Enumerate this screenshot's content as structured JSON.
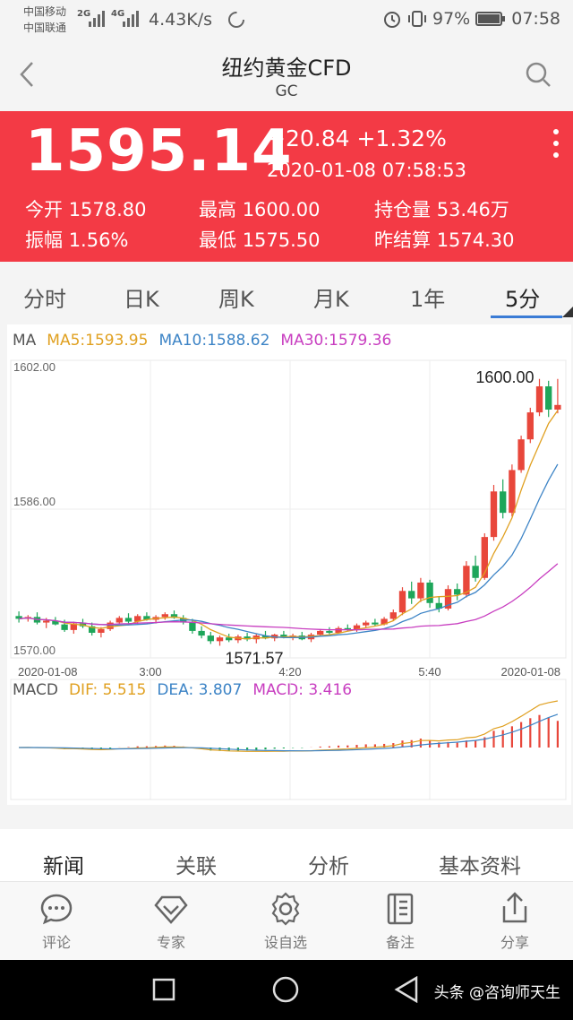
{
  "status": {
    "carrier1": "中国移动",
    "carrier2": "中国联通",
    "net1": "2G",
    "net2": "4G",
    "speed": "4.43K/s",
    "battery": "97%",
    "time": "07:58"
  },
  "header": {
    "title": "纽约黄金CFD",
    "subtitle": "GC"
  },
  "quote": {
    "price": "1595.14",
    "change": "+20.84 +1.32%",
    "datetime": "2020-01-08 07:58:53",
    "open_label": "今开",
    "open": "1578.80",
    "high_label": "最高",
    "high": "1600.00",
    "oi_label": "持仓量",
    "oi": "53.46万",
    "amp_label": "振幅",
    "amp": "1.56%",
    "low_label": "最低",
    "low": "1575.50",
    "settle_label": "昨结算",
    "settle": "1574.30"
  },
  "tabs": [
    "分时",
    "日K",
    "周K",
    "月K",
    "1年",
    "5分"
  ],
  "chart_data": {
    "type": "candlestick",
    "ma_legend": {
      "label": "MA",
      "ma5": "MA5:1593.95",
      "ma10": "MA10:1588.62",
      "ma30": "MA30:1579.36"
    },
    "macd_legend": {
      "label": "MACD",
      "dif": "DIF: 5.515",
      "dea": "DEA: 3.807",
      "macd": "MACD: 3.416"
    },
    "y_ticks": [
      "1602.00",
      "1586.00",
      "1570.00"
    ],
    "ylim": [
      1570,
      1602
    ],
    "x_ticks": [
      "2020-01-08",
      "3:00",
      "4:20",
      "5:40",
      "2020-01-08"
    ],
    "annotations": {
      "high": "1600.00",
      "low": "1571.57"
    },
    "candles": [
      [
        1574.5,
        1575.0,
        1573.8,
        1574.2
      ],
      [
        1574.2,
        1574.6,
        1573.9,
        1574.4
      ],
      [
        1574.4,
        1574.9,
        1573.6,
        1573.8
      ],
      [
        1573.8,
        1574.3,
        1573.2,
        1574.0
      ],
      [
        1574.0,
        1574.4,
        1573.5,
        1573.6
      ],
      [
        1573.6,
        1574.1,
        1572.8,
        1573.0
      ],
      [
        1573.0,
        1573.9,
        1572.6,
        1573.7
      ],
      [
        1573.7,
        1574.2,
        1573.2,
        1573.4
      ],
      [
        1573.4,
        1573.8,
        1572.4,
        1572.7
      ],
      [
        1572.7,
        1573.3,
        1572.2,
        1573.1
      ],
      [
        1573.1,
        1574.0,
        1572.9,
        1573.8
      ],
      [
        1573.8,
        1574.5,
        1573.6,
        1574.3
      ],
      [
        1574.3,
        1574.8,
        1573.7,
        1573.9
      ],
      [
        1573.9,
        1574.7,
        1573.6,
        1574.5
      ],
      [
        1574.5,
        1574.9,
        1574.0,
        1574.1
      ],
      [
        1574.1,
        1574.6,
        1573.7,
        1574.4
      ],
      [
        1574.4,
        1574.9,
        1574.1,
        1574.7
      ],
      [
        1574.7,
        1575.1,
        1574.2,
        1574.3
      ],
      [
        1574.3,
        1574.6,
        1573.6,
        1573.8
      ],
      [
        1573.8,
        1574.2,
        1572.6,
        1572.9
      ],
      [
        1572.9,
        1573.4,
        1572.1,
        1572.4
      ],
      [
        1572.4,
        1572.8,
        1571.5,
        1571.8
      ],
      [
        1571.8,
        1572.4,
        1571.3,
        1572.2
      ],
      [
        1572.2,
        1572.6,
        1571.7,
        1571.9
      ],
      [
        1571.9,
        1572.5,
        1571.6,
        1572.3
      ],
      [
        1572.3,
        1572.7,
        1571.8,
        1572.0
      ],
      [
        1572.0,
        1572.6,
        1571.57,
        1572.4
      ],
      [
        1572.4,
        1572.9,
        1572.0,
        1572.1
      ],
      [
        1572.1,
        1572.6,
        1571.8,
        1572.5
      ],
      [
        1572.5,
        1572.9,
        1572.1,
        1572.2
      ],
      [
        1572.2,
        1572.6,
        1571.9,
        1572.4
      ],
      [
        1572.4,
        1572.8,
        1571.9,
        1572.0
      ],
      [
        1572.0,
        1572.7,
        1571.7,
        1572.5
      ],
      [
        1572.5,
        1573.1,
        1572.3,
        1572.9
      ],
      [
        1572.9,
        1573.3,
        1572.5,
        1572.7
      ],
      [
        1572.7,
        1573.4,
        1572.6,
        1573.2
      ],
      [
        1573.2,
        1573.6,
        1572.9,
        1573.0
      ],
      [
        1573.0,
        1573.7,
        1572.8,
        1573.5
      ],
      [
        1573.5,
        1574.0,
        1573.2,
        1573.8
      ],
      [
        1573.8,
        1574.2,
        1573.4,
        1573.6
      ],
      [
        1573.6,
        1574.4,
        1573.5,
        1574.2
      ],
      [
        1574.2,
        1575.2,
        1574.0,
        1574.9
      ],
      [
        1574.9,
        1577.6,
        1574.6,
        1577.2
      ],
      [
        1577.2,
        1578.2,
        1575.8,
        1576.4
      ],
      [
        1576.4,
        1578.6,
        1576.0,
        1578.1
      ],
      [
        1578.1,
        1578.4,
        1575.4,
        1575.9
      ],
      [
        1575.9,
        1576.6,
        1574.9,
        1575.3
      ],
      [
        1575.3,
        1577.8,
        1575.1,
        1577.4
      ],
      [
        1577.4,
        1578.0,
        1576.2,
        1576.8
      ],
      [
        1576.8,
        1580.4,
        1576.5,
        1579.9
      ],
      [
        1579.9,
        1581.0,
        1578.2,
        1578.6
      ],
      [
        1578.6,
        1583.4,
        1578.4,
        1583.0
      ],
      [
        1583.0,
        1588.6,
        1582.6,
        1587.9
      ],
      [
        1587.9,
        1589.2,
        1585.0,
        1585.6
      ],
      [
        1585.6,
        1590.8,
        1585.2,
        1590.2
      ],
      [
        1590.2,
        1593.9,
        1589.9,
        1593.5
      ],
      [
        1593.5,
        1596.9,
        1593.1,
        1596.4
      ],
      [
        1596.4,
        1600.0,
        1596.0,
        1599.2
      ],
      [
        1599.2,
        1599.8,
        1595.9,
        1596.7
      ],
      [
        1596.7,
        1600.0,
        1596.3,
        1597.2
      ]
    ]
  },
  "subtabs": [
    "新闻",
    "关联",
    "分析",
    "基本资料"
  ],
  "bottombar": [
    "评论",
    "专家",
    "设自选",
    "备注",
    "分享"
  ],
  "watermark": "头条 @咨询师天生"
}
